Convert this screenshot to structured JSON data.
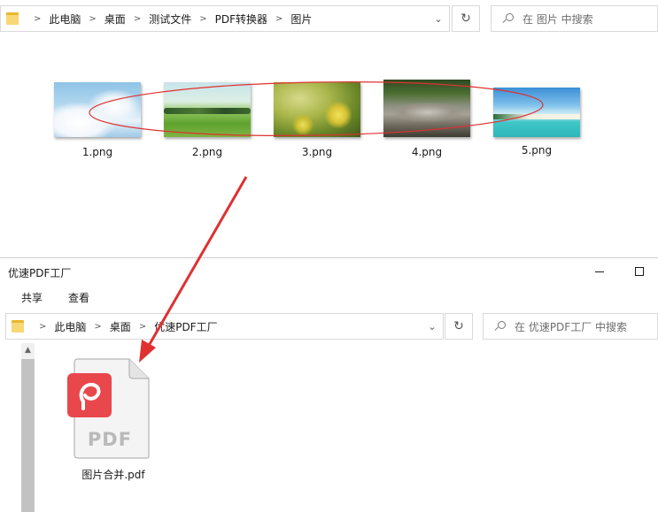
{
  "top_window": {
    "breadcrumb": [
      "此电脑",
      "桌面",
      "测试文件",
      "PDF转换器",
      "图片"
    ],
    "search_placeholder": "在 图片 中搜索",
    "files": [
      {
        "name": "1.png"
      },
      {
        "name": "2.png"
      },
      {
        "name": "3.png"
      },
      {
        "name": "4.png"
      },
      {
        "name": "5.png"
      }
    ]
  },
  "bottom_window": {
    "title": "优速PDF工厂",
    "ribbon_tabs": [
      "共享",
      "查看"
    ],
    "breadcrumb": [
      "此电脑",
      "桌面",
      "优速PDF工厂"
    ],
    "search_placeholder": "在 优速PDF工厂 中搜索",
    "file": {
      "name": "图片合并.pdf",
      "badge_text": "PDF"
    }
  },
  "icons": {
    "folder": "folder-icon",
    "chevron": "chevron-right-icon",
    "dropdown": "chevron-down-icon",
    "refresh": "refresh-icon",
    "search": "search-icon",
    "minimize": "minimize-icon",
    "maximize": "maximize-icon",
    "pdf_app": "pdf-app-icon",
    "annotation_arrow": "red-arrow-icon",
    "annotation_ellipse": "red-ellipse-annotation"
  },
  "colors": {
    "annotation_red": "#e03030",
    "pdf_badge": "#e8474c",
    "folder_yellow": "#f8d775"
  }
}
